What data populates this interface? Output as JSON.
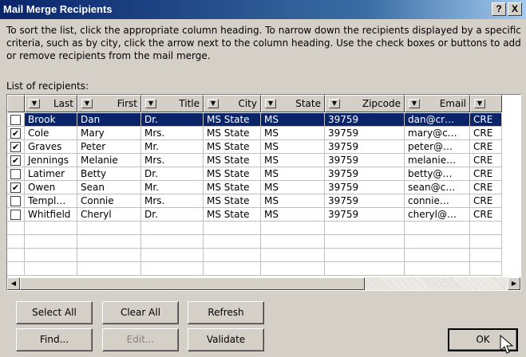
{
  "window": {
    "title": "Mail Merge Recipients",
    "help_label": "?",
    "close_label": "X"
  },
  "instructions": "To sort the list, click the appropriate column heading.  To narrow down the recipients displayed by a specific criteria, such as by city, click the arrow next to the column heading.  Use the check boxes or buttons to add or remove recipients from the mail merge.",
  "list_label": "List of recipients:",
  "columns": [
    {
      "label": "Last"
    },
    {
      "label": "First"
    },
    {
      "label": "Title"
    },
    {
      "label": "City"
    },
    {
      "label": "State"
    },
    {
      "label": "Zipcode"
    },
    {
      "label": "Email"
    },
    {
      "label": ""
    }
  ],
  "recipients": [
    {
      "checked": false,
      "selected": true,
      "last": "Brook",
      "first": "Dan",
      "title": "Dr.",
      "city": "MS State",
      "state": "MS",
      "zipcode": "39759",
      "email": "dan@cr…",
      "extra": "CRE"
    },
    {
      "checked": true,
      "selected": false,
      "last": "Cole",
      "first": "Mary",
      "title": "Mrs.",
      "city": "MS State",
      "state": "MS",
      "zipcode": "39759",
      "email": "mary@c…",
      "extra": "CRE"
    },
    {
      "checked": true,
      "selected": false,
      "last": "Graves",
      "first": "Peter",
      "title": "Mr.",
      "city": "MS State",
      "state": "MS",
      "zipcode": "39759",
      "email": "peter@…",
      "extra": "CRE"
    },
    {
      "checked": true,
      "selected": false,
      "last": "Jennings",
      "first": "Melanie",
      "title": "Mrs.",
      "city": "MS State",
      "state": "MS",
      "zipcode": "39759",
      "email": "melanie…",
      "extra": "CRE"
    },
    {
      "checked": false,
      "selected": false,
      "last": "Latimer",
      "first": "Betty",
      "title": "Dr.",
      "city": "MS State",
      "state": "MS",
      "zipcode": "39759",
      "email": "betty@…",
      "extra": "CRE"
    },
    {
      "checked": true,
      "selected": false,
      "last": "Owen",
      "first": "Sean",
      "title": "Mr.",
      "city": "MS State",
      "state": "MS",
      "zipcode": "39759",
      "email": "sean@c…",
      "extra": "CRE"
    },
    {
      "checked": false,
      "selected": false,
      "last": "Templ…",
      "first": "Connie",
      "title": "Mrs.",
      "city": "MS State",
      "state": "MS",
      "zipcode": "39759",
      "email": "connie…",
      "extra": "CRE"
    },
    {
      "checked": false,
      "selected": false,
      "last": "Whitfield",
      "first": "Cheryl",
      "title": "Dr.",
      "city": "MS State",
      "state": "MS",
      "zipcode": "39759",
      "email": "cheryl@…",
      "extra": "CRE"
    }
  ],
  "empty_rows": 4,
  "buttons": {
    "select_all": "Select All",
    "clear_all": "Clear All",
    "refresh": "Refresh",
    "find": "Find...",
    "edit": "Edit...",
    "validate": "Validate",
    "ok": "OK"
  },
  "icons": {
    "filter_arrow": "triangle-down",
    "scroll_left": "triangle-left",
    "scroll_right": "triangle-right",
    "checkmark": "check"
  }
}
